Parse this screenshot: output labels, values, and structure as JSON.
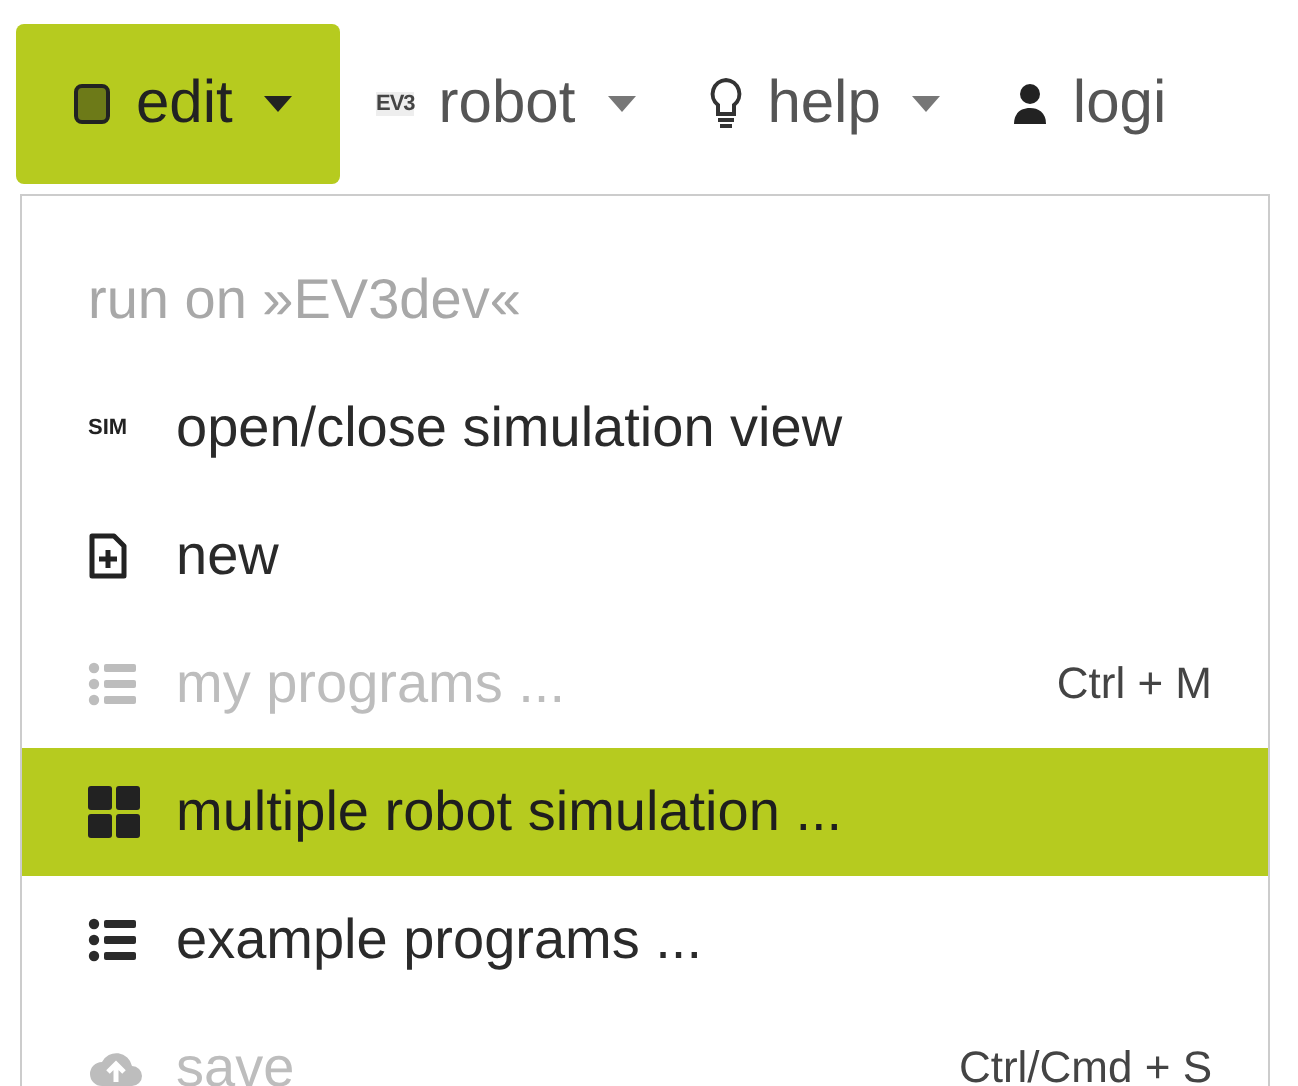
{
  "navbar": {
    "items": [
      {
        "label": "edit",
        "selected": true,
        "caret": true
      },
      {
        "label": "robot",
        "icon_text": "EV3",
        "selected": false,
        "caret": true
      },
      {
        "label": "help",
        "selected": false,
        "caret": true
      },
      {
        "label": "logi",
        "selected": false,
        "caret": false
      }
    ]
  },
  "menu": {
    "items": [
      {
        "kind": "header",
        "label": "run on »EV3dev«"
      },
      {
        "kind": "item",
        "icon_text": "SIM",
        "label": "open/close simulation view",
        "disabled": false,
        "selected": false
      },
      {
        "kind": "item",
        "label": "new",
        "disabled": false,
        "selected": false
      },
      {
        "kind": "item",
        "label": "my programs ...",
        "shortcut": "Ctrl + M",
        "disabled": true,
        "selected": false
      },
      {
        "kind": "item",
        "label": "multiple robot simulation ...",
        "disabled": false,
        "selected": true
      },
      {
        "kind": "item",
        "label": "example programs ...",
        "disabled": false,
        "selected": false
      },
      {
        "kind": "item",
        "label": "save",
        "shortcut": "Ctrl/Cmd + S",
        "disabled": true,
        "selected": false
      }
    ]
  }
}
